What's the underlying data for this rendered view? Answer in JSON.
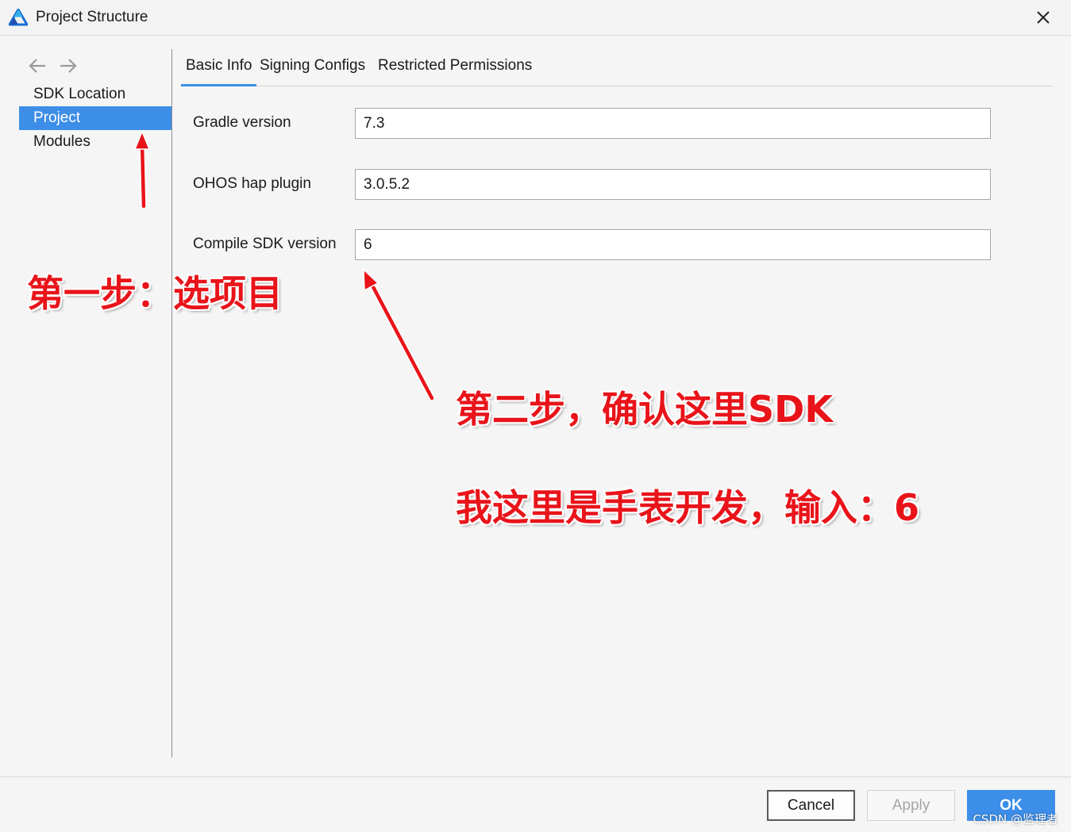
{
  "window": {
    "title": "Project Structure",
    "app_icon": "triangle-logo-icon",
    "close_icon": "close-icon"
  },
  "nav": {
    "back_icon": "arrow-left-icon",
    "forward_icon": "arrow-right-icon"
  },
  "sidebar": {
    "items": [
      {
        "label": "SDK Location",
        "selected": false
      },
      {
        "label": "Project",
        "selected": true
      },
      {
        "label": "Modules",
        "selected": false
      }
    ]
  },
  "tabs": [
    {
      "label": "Basic Info",
      "active": true
    },
    {
      "label": "Signing Configs",
      "active": false
    },
    {
      "label": "Restricted Permissions",
      "active": false
    }
  ],
  "form": {
    "fields": [
      {
        "label": "Gradle version",
        "value": "7.3"
      },
      {
        "label": "OHOS hap plugin",
        "value": "3.0.5.2"
      },
      {
        "label": "Compile SDK version",
        "value": "6"
      }
    ]
  },
  "annotations": {
    "step1": "第一步：选项目",
    "step2": "第二步，确认这里SDK",
    "step2_note": "我这里是手表开发，输入：6",
    "color": "#e8141a"
  },
  "buttons": {
    "cancel": "Cancel",
    "apply": "Apply",
    "ok": "OK"
  },
  "watermark": "CSDN @监理者",
  "colors": {
    "accent": "#3d8ee8"
  }
}
